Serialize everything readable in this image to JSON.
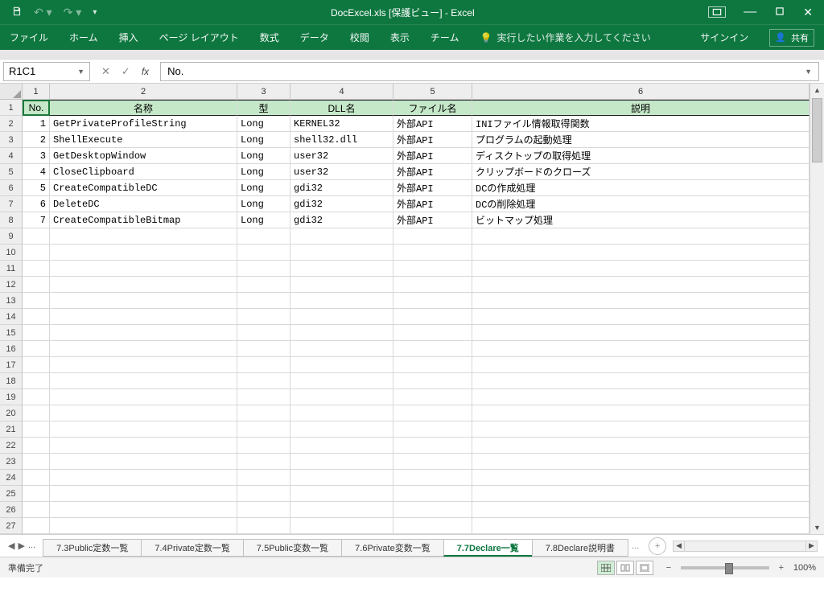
{
  "title": "DocExcel.xls [保護ビュー] - Excel",
  "ribbon": {
    "tabs": [
      "ファイル",
      "ホーム",
      "挿入",
      "ページ レイアウト",
      "数式",
      "データ",
      "校閲",
      "表示",
      "チーム"
    ],
    "tellme": "実行したい作業を入力してください",
    "signin": "サインイン",
    "share": "共有"
  },
  "namebox": "R1C1",
  "formula": "No.",
  "col_numbers": [
    "1",
    "2",
    "3",
    "4",
    "5",
    "6"
  ],
  "headers": [
    "No.",
    "名称",
    "型",
    "DLL名",
    "ファイル名",
    "説明"
  ],
  "rows": [
    {
      "no": "1",
      "name": "GetPrivateProfileString",
      "type": "Long",
      "dll": "KERNEL32",
      "file": "外部API",
      "desc": "INIファイル情報取得関数"
    },
    {
      "no": "2",
      "name": "ShellExecute",
      "type": "Long",
      "dll": "shell32.dll",
      "file": "外部API",
      "desc": "プログラムの起動処理"
    },
    {
      "no": "3",
      "name": "GetDesktopWindow",
      "type": "Long",
      "dll": "user32",
      "file": "外部API",
      "desc": "ディスクトップの取得処理"
    },
    {
      "no": "4",
      "name": "CloseClipboard",
      "type": "Long",
      "dll": "user32",
      "file": "外部API",
      "desc": "クリップボードのクローズ"
    },
    {
      "no": "5",
      "name": "CreateCompatibleDC",
      "type": "Long",
      "dll": "gdi32",
      "file": "外部API",
      "desc": "DCの作成処理"
    },
    {
      "no": "6",
      "name": "DeleteDC",
      "type": "Long",
      "dll": "gdi32",
      "file": "外部API",
      "desc": "DCの削除処理"
    },
    {
      "no": "7",
      "name": "CreateCompatibleBitmap",
      "type": "Long",
      "dll": "gdi32",
      "file": "外部API",
      "desc": "ビットマップ処理"
    }
  ],
  "empty_row_count": 19,
  "row_count": 27,
  "sheets": [
    "7.3Public定数一覧",
    "7.4Private定数一覧",
    "7.5Public変数一覧",
    "7.6Private変数一覧",
    "7.7Declare一覧",
    "7.8Declare説明書"
  ],
  "active_sheet": 4,
  "status": "準備完了",
  "zoom": "100%"
}
